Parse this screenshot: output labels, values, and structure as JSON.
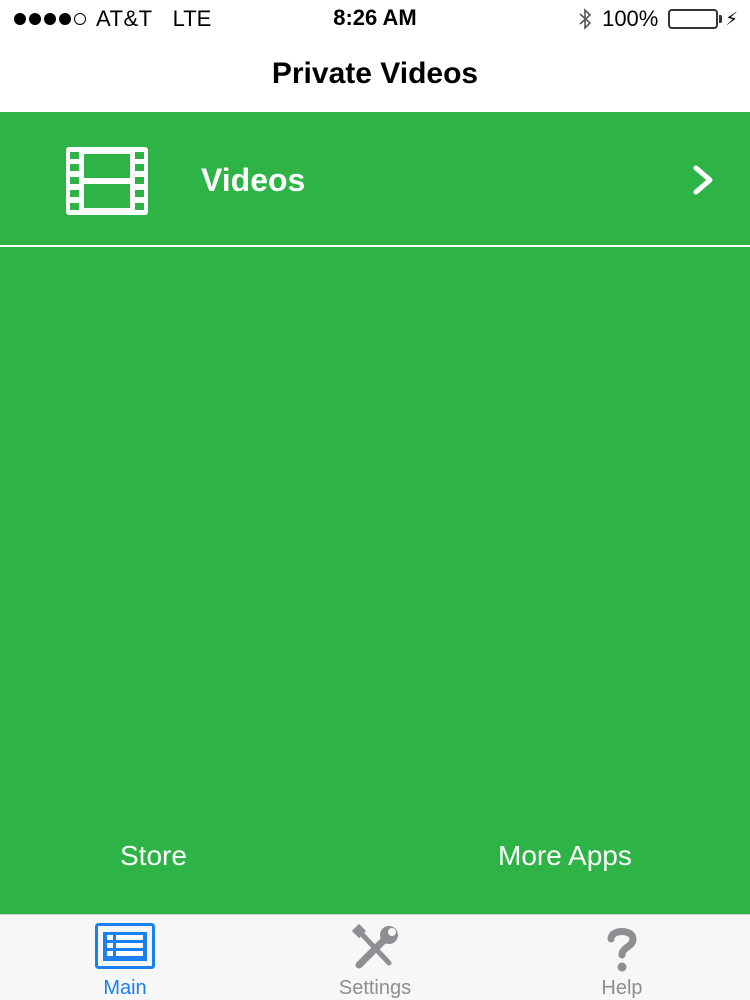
{
  "status_bar": {
    "carrier": "AT&T",
    "network": "LTE",
    "time": "8:26 AM",
    "battery_percent": "100%",
    "battery_level": 1.0,
    "signal_bars_filled": 4,
    "signal_bars_total": 5,
    "icons": [
      "signal-dots-icon",
      "bluetooth-icon",
      "battery-icon",
      "charging-bolt-icon"
    ]
  },
  "nav": {
    "title": "Private Videos"
  },
  "main": {
    "background_color": "#2db346",
    "menu_items": [
      {
        "label": "Videos",
        "icon": "film-icon",
        "accessory": "chevron-right-icon"
      }
    ],
    "store_label": "Store",
    "more_apps_label": "More Apps"
  },
  "tab_bar": {
    "tabs": [
      {
        "label": "Main",
        "icon": "list-icon",
        "active": true
      },
      {
        "label": "Settings",
        "icon": "tools-icon",
        "active": false
      },
      {
        "label": "Help",
        "icon": "question-mark-icon",
        "active": false
      }
    ],
    "active_color": "#1a7ff0",
    "inactive_color": "#8e8e93"
  }
}
